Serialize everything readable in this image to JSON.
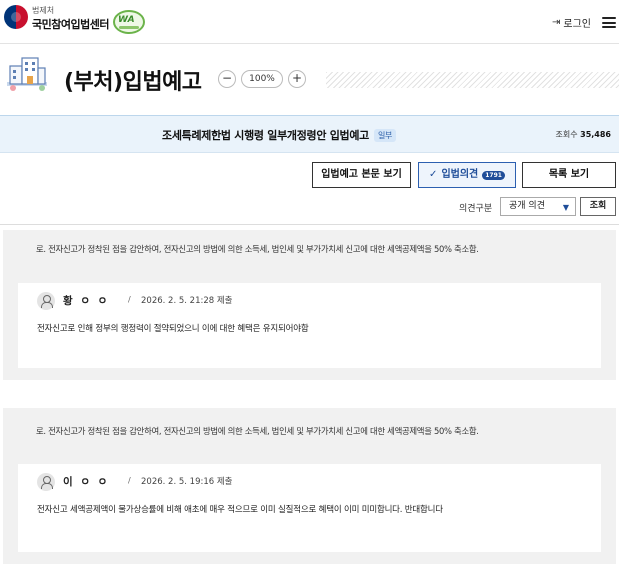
{
  "header": {
    "org_small": "법제처",
    "org_main": "국민참여입법센터",
    "logo_badge": "WA",
    "login_label": "로그인",
    "icons": [
      "gov-emblem",
      "wa-logo",
      "login-icon",
      "menu-icon"
    ]
  },
  "page": {
    "title": "(부처)입법예고",
    "zoom_minus": "−",
    "zoom_value": "100%",
    "zoom_plus": "+"
  },
  "bill": {
    "title": "조세특례제한법 시행령 일부개정령안 입법예고",
    "badge": "일부",
    "views_label": "조회수",
    "views_value": "35,486"
  },
  "actions": {
    "body_view": "입법예고 본문 보기",
    "opinion_label": "입법의견",
    "opinion_count": "1791",
    "list_view": "목록 보기"
  },
  "filter": {
    "label": "의견구분",
    "selected": "공개 의견",
    "search": "조회"
  },
  "opinions": [
    {
      "quote": "로. 전자신고가 정착된 점을 감안하여, 전자신고의 방법에 의한 소득세, 법인세 및 부가가치세 신고에 대한 세액공제액을 50% 축소함.",
      "name": "황 ㅇ ㅇ",
      "separator": "/",
      "date": "2026. 2. 5. 21:28 제출",
      "text": "전자신고로 인해 정부의 행정력이 절약되었으니 이에 대한 혜택은 유지되어야함"
    },
    {
      "quote": "로. 전자신고가 정착된 점을 감안하여, 전자신고의 방법에 의한 소득세, 법인세 및 부가가치세 신고에 대한 세액공제액을 50% 축소함.",
      "name": "이 ㅇ ㅇ",
      "separator": "/",
      "date": "2026. 2. 5. 19:16 제출",
      "text": "전자신고 세액공제액이 물가상승률에 비해 애초에 매우 적으므로 이미 실질적으로 혜택이 이미 미미합니다. 반대합니다"
    }
  ],
  "colors": {
    "accent": "#1f4d99",
    "bill_header_bg": "#eaf3fb",
    "opinion_bg": "#f1f1f1"
  }
}
